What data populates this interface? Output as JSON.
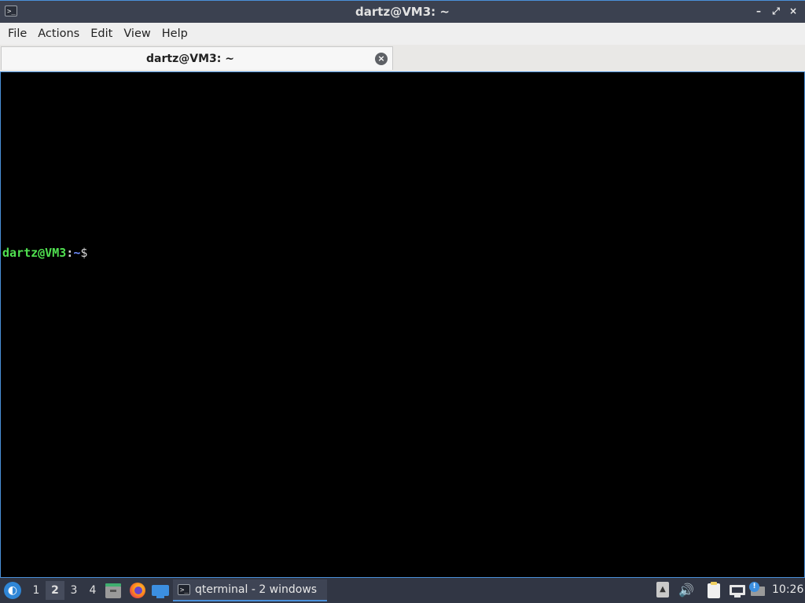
{
  "window": {
    "title": "dartz@VM3: ~",
    "app_icon": ">_",
    "controls": {
      "minimize": "–",
      "maximize": "⤢",
      "close": "×"
    }
  },
  "menubar": {
    "items": [
      "File",
      "Actions",
      "Edit",
      "View",
      "Help"
    ]
  },
  "tabs": [
    {
      "label": "dartz@VM3: ~",
      "close": "×"
    }
  ],
  "terminal": {
    "prompt_user": "dartz@VM3",
    "prompt_colon": ":",
    "prompt_path": "~",
    "prompt_symbol": "$",
    "colors": {
      "user": "#50e050",
      "path": "#6f8cff",
      "background": "#000000"
    }
  },
  "taskbar": {
    "start_icon": "start-menu-icon",
    "desktops": [
      "1",
      "2",
      "3",
      "4"
    ],
    "active_desktop": "2",
    "quicklaunch": [
      "file-manager-icon",
      "firefox-icon",
      "show-desktop-icon"
    ],
    "task_icon": ">_",
    "task_label": "qterminal - 2 windows",
    "tray": [
      "updown-icon",
      "volume-icon",
      "clipboard-icon",
      "network-icon",
      "update-notifier-icon"
    ],
    "volume_glyph": "🔊",
    "updown_glyph": "▲",
    "update_badge": "!",
    "clock": "10:26"
  }
}
